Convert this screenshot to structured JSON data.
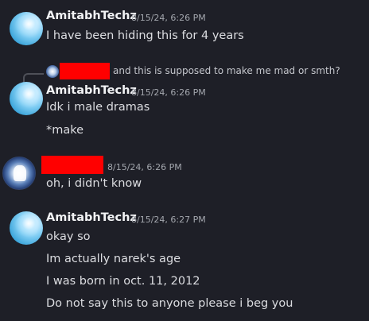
{
  "messages": {
    "group1": {
      "username": "AmitabhTechz",
      "timestamp": "8/15/24, 6:26 PM",
      "lines": [
        "I have been hiding this for 4 years"
      ]
    },
    "reply": {
      "text": "and this is supposed to make me mad or smth?"
    },
    "group2": {
      "username": "AmitabhTechz",
      "timestamp": "8/15/24, 6:26 PM",
      "lines": [
        "Idk i male dramas",
        "*make"
      ]
    },
    "group3": {
      "timestamp": "8/15/24, 6:26 PM",
      "lines": [
        "oh, i didn't know"
      ]
    },
    "group4": {
      "username": "AmitabhTechz",
      "timestamp": "8/15/24, 6:27 PM",
      "lines": [
        "okay so",
        "Im actually narek's age",
        "I was born in oct. 11, 2012",
        "Do not say this to anyone please i beg you"
      ]
    }
  },
  "colors": {
    "background": "#1e1f27",
    "username": "#f2f3f5",
    "timestamp": "#a3a6ad",
    "message": "#dcdde1",
    "redaction": "#ff0000"
  },
  "icons": {
    "avatar_user1": "blue-orb-avatar",
    "avatar_user2": "badge-avatar"
  }
}
